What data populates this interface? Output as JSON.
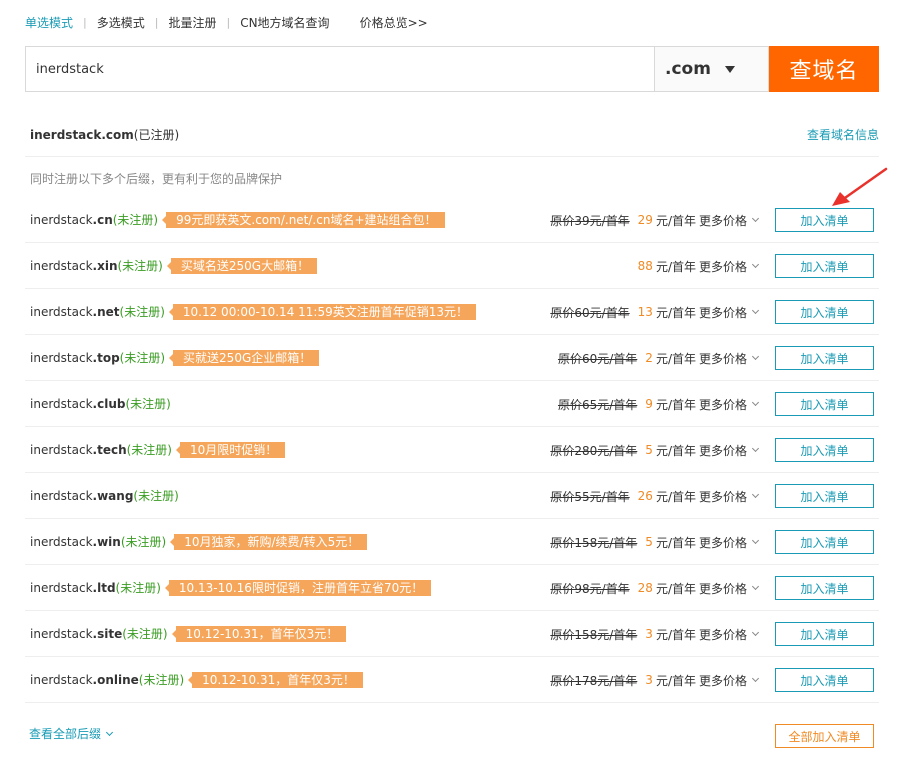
{
  "tabs": [
    {
      "label": "单选模式",
      "active": true
    },
    {
      "label": "多选模式",
      "active": false
    },
    {
      "label": "批量注册",
      "active": false
    },
    {
      "label": "CN地方域名查询",
      "active": false
    },
    {
      "label": "价格总览>>",
      "active": false
    }
  ],
  "search": {
    "value": "inerdstack",
    "suffix": ".com",
    "button_label": "查域名"
  },
  "result": {
    "domain": "inerdstack.com",
    "status": "(已注册)",
    "view_info_label": "查看域名信息"
  },
  "hint": "同时注册以下多个后缀，更有利于您的品牌保护",
  "domains": [
    {
      "name": "inerdstack",
      "suffix": ".cn",
      "status": "(未注册)",
      "promo": "99元即获英文.com/.net/.cn域名+建站组合包！",
      "original_price": "原价39元/首年",
      "price": "29",
      "unit": "元/首年",
      "more": "更多价格",
      "add_label": "加入清单"
    },
    {
      "name": "inerdstack",
      "suffix": ".xin",
      "status": "(未注册)",
      "promo": "买域名送250G大邮箱！",
      "original_price": "",
      "price": "88",
      "unit": "元/首年",
      "more": "更多价格",
      "add_label": "加入清单"
    },
    {
      "name": "inerdstack",
      "suffix": ".net",
      "status": "(未注册)",
      "promo": "10.12 00:00-10.14 11:59英文注册首年促销13元！",
      "original_price": "原价60元/首年",
      "price": "13",
      "unit": "元/首年",
      "more": "更多价格",
      "add_label": "加入清单"
    },
    {
      "name": "inerdstack",
      "suffix": ".top",
      "status": "(未注册)",
      "promo": "买就送250G企业邮箱！",
      "original_price": "原价60元/首年",
      "price": "2",
      "unit": "元/首年",
      "more": "更多价格",
      "add_label": "加入清单"
    },
    {
      "name": "inerdstack",
      "suffix": ".club",
      "status": "(未注册)",
      "promo": "",
      "original_price": "原价65元/首年",
      "price": "9",
      "unit": "元/首年",
      "more": "更多价格",
      "add_label": "加入清单"
    },
    {
      "name": "inerdstack",
      "suffix": ".tech",
      "status": "(未注册)",
      "promo": "10月限时促销！",
      "original_price": "原价280元/首年",
      "price": "5",
      "unit": "元/首年",
      "more": "更多价格",
      "add_label": "加入清单"
    },
    {
      "name": "inerdstack",
      "suffix": ".wang",
      "status": "(未注册)",
      "promo": "",
      "original_price": "原价55元/首年",
      "price": "26",
      "unit": "元/首年",
      "more": "更多价格",
      "add_label": "加入清单"
    },
    {
      "name": "inerdstack",
      "suffix": ".win",
      "status": "(未注册)",
      "promo": "10月独家，新购/续费/转入5元！",
      "original_price": "原价158元/首年",
      "price": "5",
      "unit": "元/首年",
      "more": "更多价格",
      "add_label": "加入清单"
    },
    {
      "name": "inerdstack",
      "suffix": ".ltd",
      "status": "(未注册)",
      "promo": "10.13-10.16限时促销，注册首年立省70元！",
      "original_price": "原价98元/首年",
      "price": "28",
      "unit": "元/首年",
      "more": "更多价格",
      "add_label": "加入清单"
    },
    {
      "name": "inerdstack",
      "suffix": ".site",
      "status": "(未注册)",
      "promo": "10.12-10.31，首年仅3元！",
      "original_price": "原价158元/首年",
      "price": "3",
      "unit": "元/首年",
      "more": "更多价格",
      "add_label": "加入清单"
    },
    {
      "name": "inerdstack",
      "suffix": ".online",
      "status": "(未注册)",
      "promo": "10.12-10.31，首年仅3元！",
      "original_price": "原价178元/首年",
      "price": "3",
      "unit": "元/首年",
      "more": "更多价格",
      "add_label": "加入清单"
    }
  ],
  "footer": {
    "view_all_label": "查看全部后缀",
    "add_all_label": "全部加入清单"
  },
  "colors": {
    "accent": "#1a9bb5",
    "brand_orange": "#ff6600",
    "promo": "#f5a65b",
    "price": "#f08a24",
    "available": "#3a9d23",
    "annotation_arrow": "#e8322b"
  }
}
